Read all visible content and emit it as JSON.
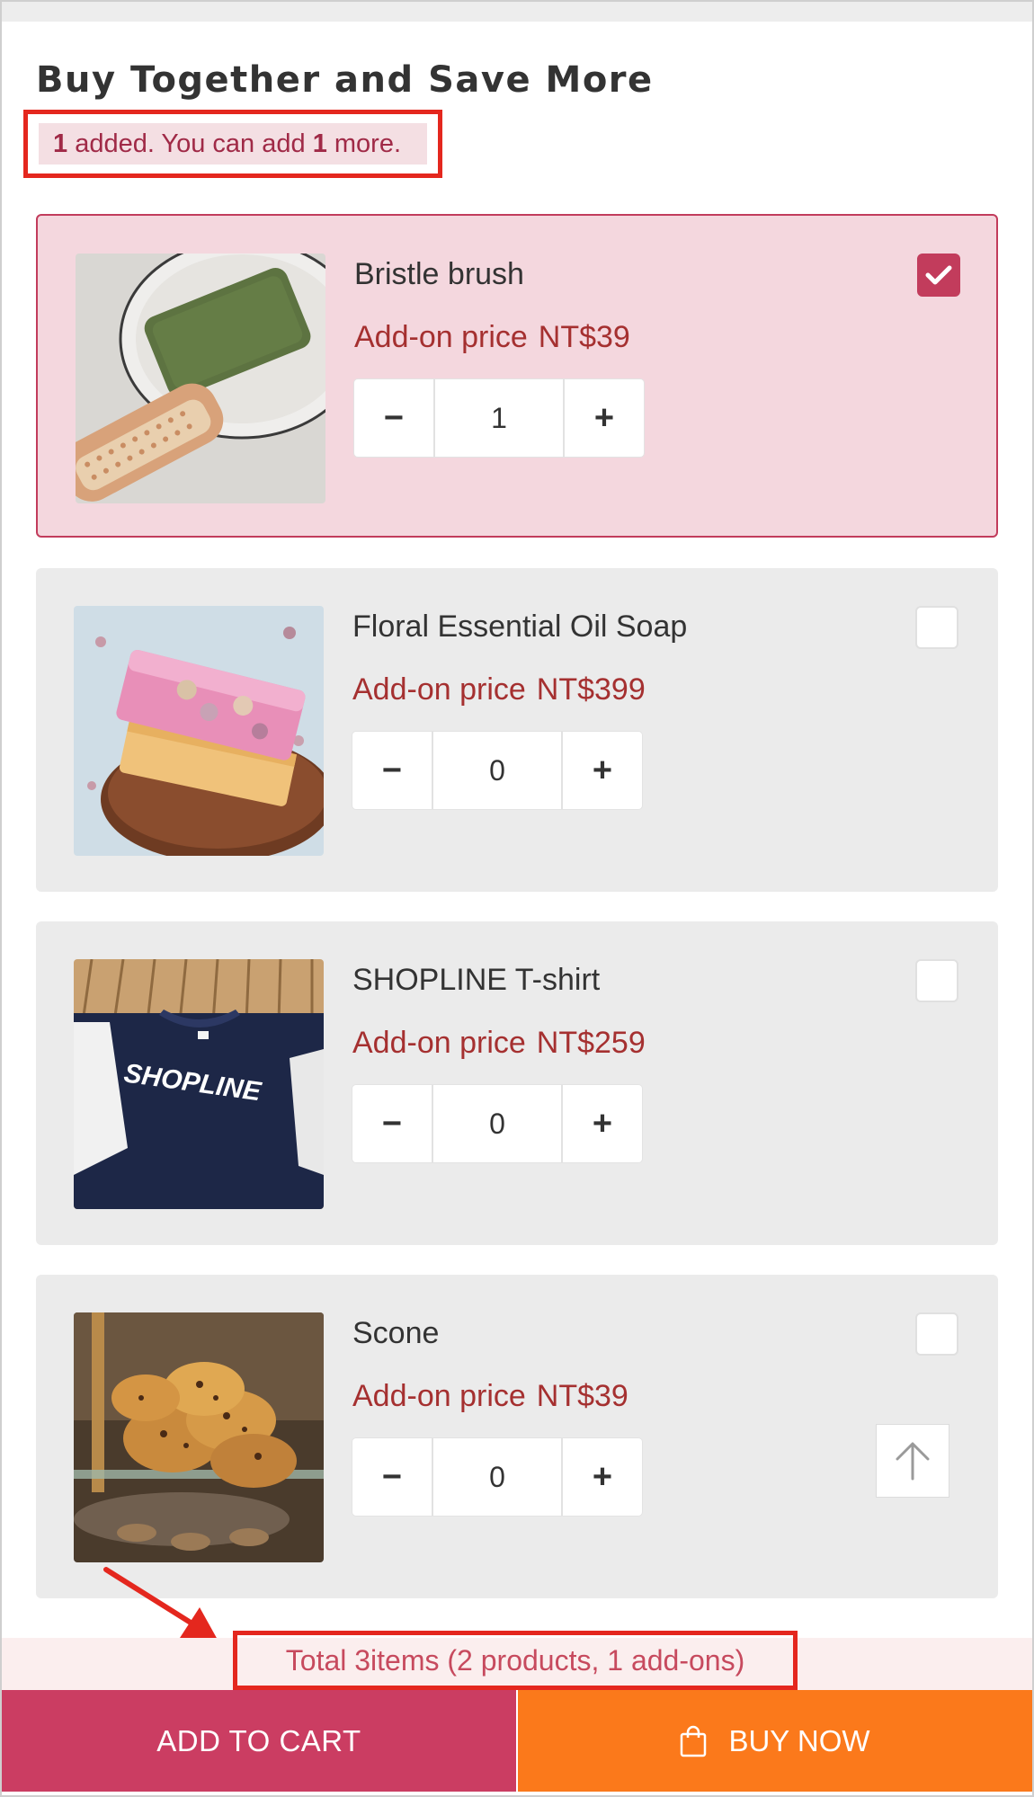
{
  "section": {
    "title": "Buy Together and Save More",
    "added_count": "1",
    "added_text": " added. You can add ",
    "remaining_count": "1",
    "remaining_text": " more."
  },
  "products": [
    {
      "name": "Bristle brush",
      "price_label": "Add-on price",
      "price": "NT$39",
      "quantity": "1",
      "selected": true,
      "image": "bristle-brush-with-green-soap"
    },
    {
      "name": "Floral Essential Oil Soap",
      "price_label": "Add-on price",
      "price": "NT$399",
      "quantity": "0",
      "selected": false,
      "image": "pink-floral-soap-bar"
    },
    {
      "name": "SHOPLINE T-shirt",
      "price_label": "Add-on price",
      "price": "NT$259",
      "quantity": "0",
      "selected": false,
      "image": "navy-shopline-tshirt"
    },
    {
      "name": "Scone",
      "price_label": "Add-on price",
      "price": "NT$39",
      "quantity": "0",
      "selected": false,
      "image": "scones-on-display"
    }
  ],
  "stepper": {
    "minus": "−",
    "plus": "+"
  },
  "summary": {
    "text": "Total 3items (2 products, 1 add-ons)"
  },
  "image_text": {
    "tshirt_logo": "SHOPLINE"
  },
  "actions": {
    "add_to_cart": "ADD TO CART",
    "buy_now": "BUY NOW"
  },
  "icons": {
    "checkbox": "check-icon",
    "scroll_top": "arrow-up-icon",
    "buy": "shopping-bag-icon"
  },
  "colors": {
    "accent": "#c23c5c",
    "price": "#a53030",
    "buy_now": "#fb791b",
    "add_to_cart": "#cb3d62",
    "highlight": "#e4271e"
  }
}
